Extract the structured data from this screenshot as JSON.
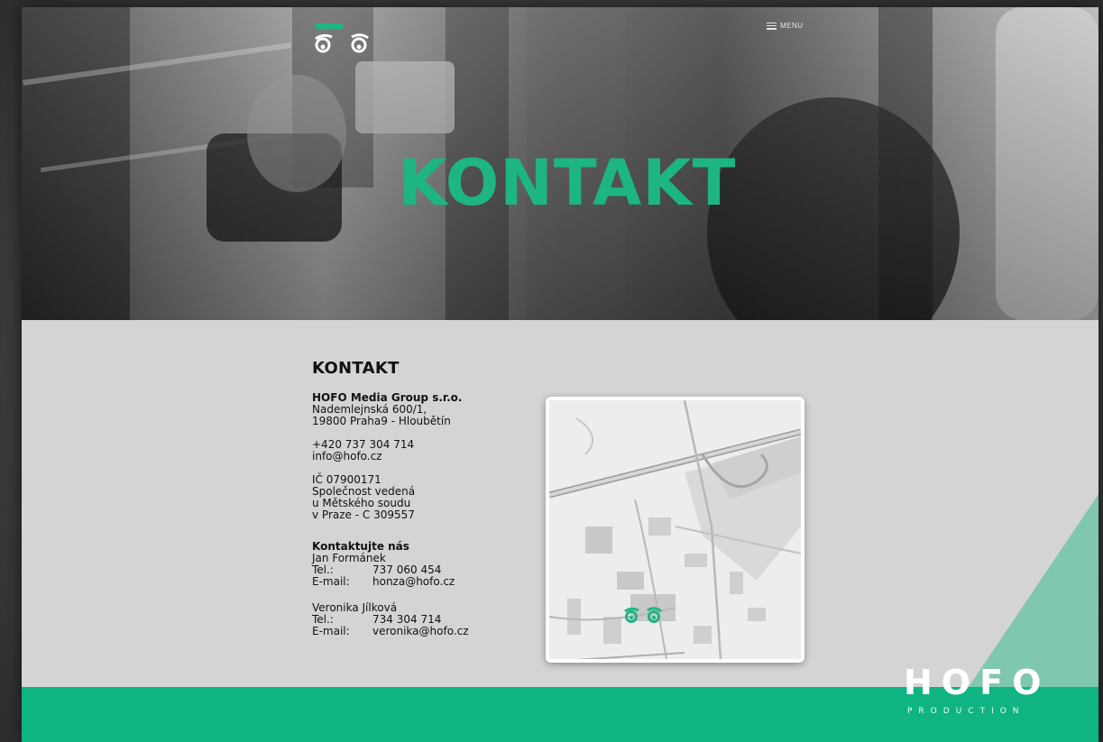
{
  "header": {
    "logo_icon": "eyes-logo-icon",
    "menu_label": "MENU",
    "menu_icon": "hamburger-icon",
    "hero_title": "KONTAKT"
  },
  "contact": {
    "heading": "KONTAKT",
    "company": "HOFO Media Group s.r.o.",
    "address_line1": "Nademlejnská 600/1,",
    "address_line2": "19800 Praha9 - Hloubětín",
    "phone": "+420 737 304 714",
    "email": "info@hofo.cz",
    "ic": "IČ 07900171",
    "registry_line1": "Společnost vedená",
    "registry_line2": "u Mětského soudu",
    "registry_line3": "v Praze - C 309557",
    "contact_us": "Kontaktujte nás",
    "persons": [
      {
        "name": "Jan Formánek",
        "tel_label": "Tel.:",
        "tel": "737 060 454",
        "email_label": "E-mail:",
        "email": "honza@hofo.cz"
      },
      {
        "name": "Veronika Jílková",
        "tel_label": "Tel.:",
        "tel": "734 304 714",
        "email_label": "E-mail:",
        "email": "veronika@hofo.cz"
      }
    ]
  },
  "map": {
    "marker_icon": "eyes-logo-icon"
  },
  "brand": {
    "name": "HOFO",
    "sub": "PRODUCTION"
  },
  "colors": {
    "accent": "#1db584",
    "footer": "#0fb482",
    "triangle": "#7fc8ad",
    "page_bg": "#d4d4d4"
  }
}
